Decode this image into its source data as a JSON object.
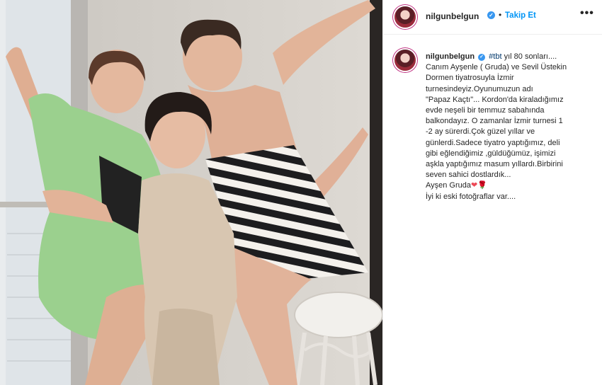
{
  "post": {
    "username": "nilgunbelgun",
    "verified_badge": "✓",
    "follow_label": "Takip Et",
    "more_label": "•••",
    "separator": "•",
    "caption": {
      "hashtag": "#tbt",
      "lines": [
        "yıl 80 sonları....",
        "Canım Ayşenle ( Gruda) ve Sevil Üstekin",
        "Dormen tiyatrosuyla İzmir",
        "turnesindeyiz.Oyunumuzun adı",
        "\"Papaz Kaçtı\"... Kordon'da kiraladığımız",
        "evde neşeli bir temmuz sabahında",
        "balkondayız. O zamanlar İzmir turnesi 1",
        "-2 ay sürerdi.Çok güzel yıllar ve",
        "günlerdi.Sadece tiyatro yaptığımız, deli",
        "gibi eğlendiğimiz ,güldüğümüz, işimizi",
        "aşkla yaptığımız masum yıllardı.Birbirini",
        "seven sahici dostlardık...",
        "Ayşen Gruda",
        "İyi ki eski fotoğraflar var...."
      ],
      "emoji": "❤🌹"
    }
  },
  "icons": {
    "avatar": "profile-avatar-icon",
    "verified": "verified-badge-icon",
    "more": "more-options-icon"
  },
  "colors": {
    "accent_blue": "#0095f6",
    "verified_blue": "#3897f0",
    "hashtag": "#00376b",
    "heart": "#ed4956"
  }
}
